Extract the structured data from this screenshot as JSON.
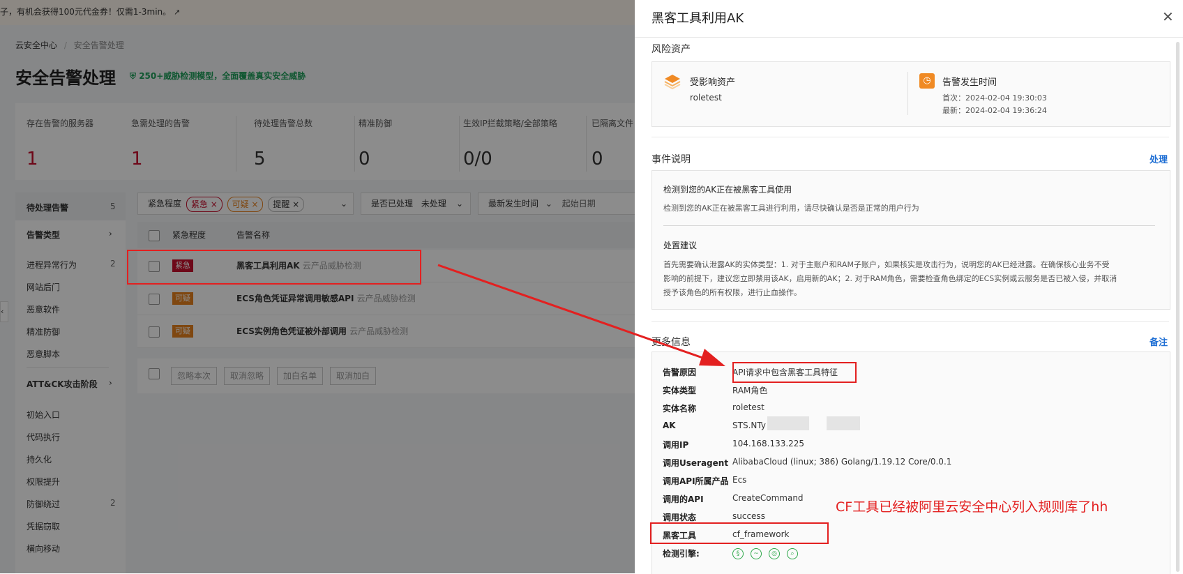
{
  "banner": {
    "text": "子，有机会获得100元代金券！仅需1-3min。"
  },
  "breadcrumb": {
    "root": "云安全中心",
    "current": "安全告警处理"
  },
  "page": {
    "title": "安全告警处理",
    "promo": "250+威胁检测模型，全面覆盖真实安全威胁"
  },
  "stats": [
    {
      "label": "存在告警的服务器",
      "value": "1"
    },
    {
      "label": "急需处理的告警",
      "value": "1"
    },
    {
      "label": "待处理告警总数",
      "value": "5"
    },
    {
      "label": "精准防御",
      "value": "0"
    },
    {
      "label": "生效IP拦截策略/全部策略",
      "value": "0/0"
    },
    {
      "label": "已隔离文件",
      "value": "0"
    }
  ],
  "sidebar": {
    "pending": {
      "label": "待处理告警",
      "count": "5"
    },
    "types_head": "告警类型",
    "types": [
      {
        "label": "进程异常行为",
        "count": "2"
      },
      {
        "label": "网站后门",
        "count": ""
      },
      {
        "label": "恶意软件",
        "count": ""
      },
      {
        "label": "精准防御",
        "count": ""
      },
      {
        "label": "恶意脚本",
        "count": ""
      }
    ],
    "attck_head": "ATT&CK攻击阶段",
    "attck": [
      {
        "label": "初始入口",
        "count": ""
      },
      {
        "label": "代码执行",
        "count": ""
      },
      {
        "label": "持久化",
        "count": ""
      },
      {
        "label": "权限提升",
        "count": ""
      },
      {
        "label": "防御绕过",
        "count": "2"
      },
      {
        "label": "凭据窃取",
        "count": ""
      },
      {
        "label": "横向移动",
        "count": ""
      }
    ]
  },
  "filters": {
    "severity_label": "紧急程度",
    "tags": [
      "紧急",
      "可疑",
      "提醒"
    ],
    "handled_label": "是否已处理",
    "handled_value": "未处理",
    "time_label": "最新发生时间",
    "date_placeholder": "起始日期"
  },
  "table": {
    "col_level": "紧急程度",
    "col_name": "告警名称",
    "rows": [
      {
        "level": "紧急",
        "name": "黑客工具利用AK",
        "source": "云产品威胁检测"
      },
      {
        "level": "可疑",
        "name": "ECS角色凭证异常调用敏感API",
        "source": "云产品威胁检测"
      },
      {
        "level": "可疑",
        "name": "ECS实例角色凭证被外部调用",
        "source": "云产品威胁检测"
      }
    ],
    "bulk": [
      "忽略本次",
      "取消忽略",
      "加白名单",
      "取消加白"
    ]
  },
  "drawer": {
    "title": "黑客工具利用AK",
    "risk_title": "风险资产",
    "asset_label": "受影响资产",
    "asset_value": "roletest",
    "time_label": "告警发生时间",
    "first": "首次：2024-02-04 19:30:03",
    "latest": "最新：2024-02-04 19:36:24",
    "event_title": "事件说明",
    "event_action": "处理",
    "event_head": "检测到您的AK正在被黑客工具使用",
    "event_desc": "检测到您的AK正在被黑客工具进行利用，请尽快确认是否是正常的用户行为",
    "advice_title": "处置建议",
    "advice_l1": "首先需要确认泄露AK的实体类型：1. 对于主账户和RAM子账户，如果核实是攻击行为，说明您的AK已经泄露。在确保核心业务不受",
    "advice_l2": "影响的前提下，建议您立即禁用该AK，启用新的AK；2. 对于RAM角色，需要检查角色绑定的ECS实例或云服务是否已被入侵，并取消",
    "advice_l3": "授予该角色的所有权限，进行止血操作。",
    "more_title": "更多信息",
    "more_action": "备注",
    "details": [
      {
        "k": "告警原因",
        "v": "API请求中包含黑客工具特征"
      },
      {
        "k": "实体类型",
        "v": "RAM角色"
      },
      {
        "k": "实体名称",
        "v": "roletest"
      },
      {
        "k": "AK",
        "v": "STS.NTy"
      },
      {
        "k": "调用IP",
        "v": "104.168.133.225"
      },
      {
        "k": "调用Useragent",
        "v": "AlibabaCloud (linux; 386) Golang/1.19.12 Core/0.0.1"
      },
      {
        "k": "调用API所属产品",
        "v": "Ecs"
      },
      {
        "k": "调用的API",
        "v": "CreateCommand"
      },
      {
        "k": "调用状态",
        "v": "success"
      },
      {
        "k": "黑客工具",
        "v": "cf_framework"
      },
      {
        "k": "检测引擎:",
        "v": ""
      }
    ]
  },
  "annotation": "CF工具已经被阿里云安全中心列入规则库了hh",
  "colors": {
    "urgent": "#c8102e",
    "suspicious": "#e8821e",
    "link": "#1f6fd4",
    "annotation": "#e32020"
  }
}
